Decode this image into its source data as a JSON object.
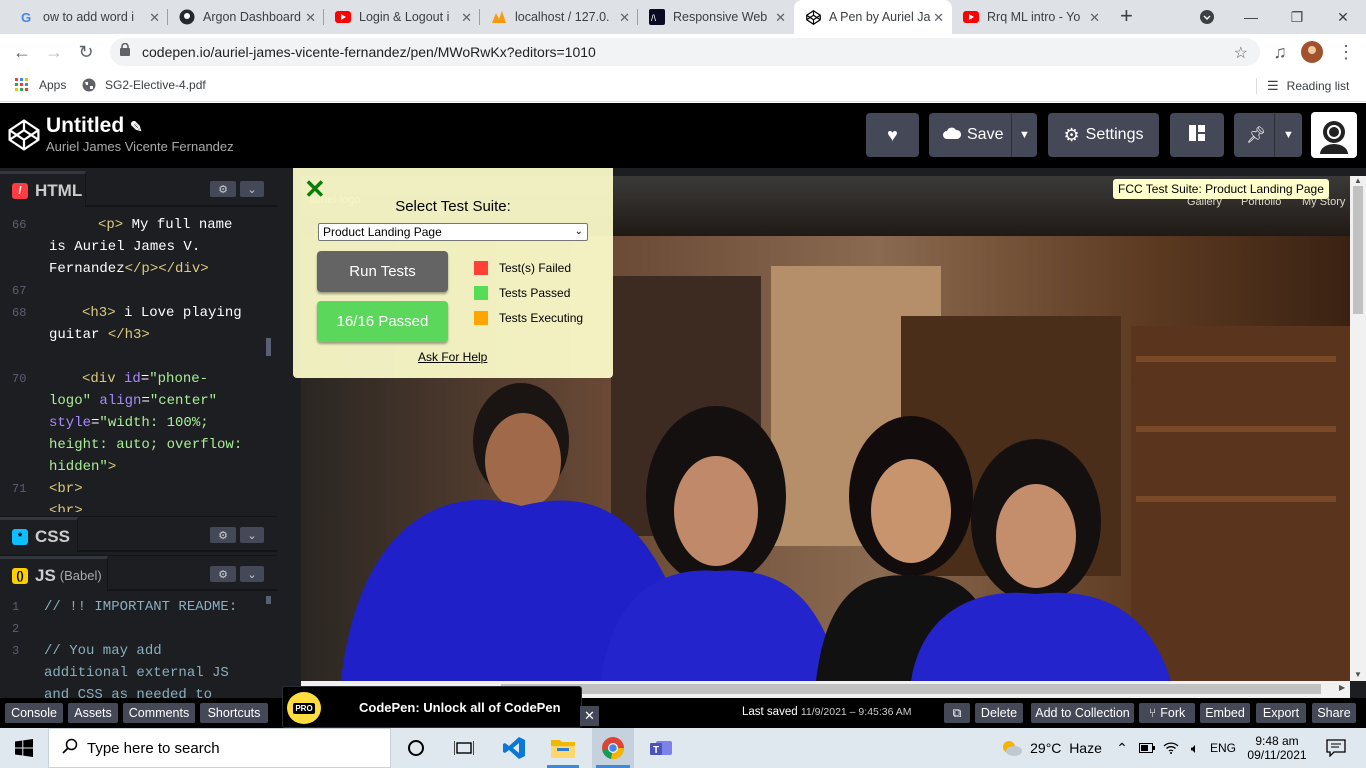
{
  "browser": {
    "tabs": [
      {
        "title": "ow to add word i",
        "icon": "google-icon",
        "active": false
      },
      {
        "title": "Argon Dashboard",
        "icon": "github-icon",
        "active": false
      },
      {
        "title": "Login & Logout i",
        "icon": "youtube-icon",
        "active": false
      },
      {
        "title": "localhost / 127.0.",
        "icon": "phpmyadmin-icon",
        "active": false
      },
      {
        "title": "Responsive Web",
        "icon": "freecodecamp-icon",
        "active": false
      },
      {
        "title": "A Pen by Auriel Ja",
        "icon": "codepen-icon",
        "active": true
      },
      {
        "title": "Rrq ML intro - Yo",
        "icon": "youtube-icon",
        "active": false
      }
    ],
    "url": "codepen.io/auriel-james-vicente-fernandez/pen/MWoRwKx?editors=1010",
    "bookmarks": [
      {
        "label": "Apps",
        "icon": "apps-grid-icon"
      },
      {
        "label": "SG2-Elective-4.pdf",
        "icon": "globe-icon"
      }
    ],
    "reading_list": "Reading list"
  },
  "codepen": {
    "title": "Untitled",
    "author": "Auriel James Vicente Fernandez",
    "save": "Save",
    "settings": "Settings",
    "html_label": "HTML",
    "css_label": "CSS",
    "js_label": "JS",
    "js_sub": "(Babel)",
    "html_lines": {
      "l66": "66",
      "l67": "67",
      "l68": "68",
      "l70": "70",
      "l71": "71",
      "c66a_tag": "<p>",
      "c66a_txt": " My full name",
      "c66b": "is Auriel James V.",
      "c66c_txt": "Fernandez",
      "c66c_tag": "</p></div>",
      "c68a_tag": "<h3>",
      "c68a_txt": " i Love playing",
      "c68b_txt": "guitar ",
      "c68b_tag": "</h3>",
      "c70a_tag": "<div ",
      "c70a_atr": "id",
      "c70a_str": "\"phone-",
      "c70b_str": "logo\"",
      "c70b_atr": " align",
      "c70b_str2": "\"center\"",
      "c70c_atr": "style",
      "c70c_str": "\"width: 100%;",
      "c70d_str": "height: auto; overflow:",
      "c70e_str": "hidden\"",
      "c70e_tag": ">",
      "c71a": "<br>",
      "c71b": "<br>"
    },
    "js_lines": {
      "l1": "1",
      "l2": "2",
      "l3": "3",
      "c1": "// !! IMPORTANT README:",
      "c3a": "// You may add",
      "c3b": "additional external JS",
      "c3c": "and CSS as needed to"
    },
    "footer": {
      "console": "Console",
      "assets": "Assets",
      "comments": "Comments",
      "shortcuts": "Shortcuts",
      "promo": "CodePen: Unlock all of CodePen",
      "pro": "PRO",
      "last_saved_label": "Last saved",
      "last_saved_value": "11/9/2021 – 9:45:36 AM",
      "delete": "Delete",
      "add_collection": "Add to Collection",
      "fork": "Fork",
      "embed": "Embed",
      "export": "Export",
      "share": "Share"
    }
  },
  "fcc": {
    "title": "Select Test Suite:",
    "selected": "Product Landing Page",
    "run": "Run Tests",
    "result": "16/16 Passed",
    "legend": [
      {
        "label": "Test(s) Failed",
        "color": "#ff4136"
      },
      {
        "label": "Tests Passed",
        "color": "#55dd55"
      },
      {
        "label": "Tests Executing",
        "color": "#ffa500"
      }
    ],
    "help": "Ask For Help",
    "badge": "FCC Test Suite: Product Landing Page"
  },
  "site": {
    "logo": "auriel-logo",
    "nav": [
      "Gallery",
      "Portfolio",
      "My Story"
    ]
  },
  "taskbar": {
    "search": "Type here to search",
    "temp": "29°C",
    "weather": "Haze",
    "lang": "ENG",
    "time": "9:48 am",
    "date": "09/11/2021"
  }
}
